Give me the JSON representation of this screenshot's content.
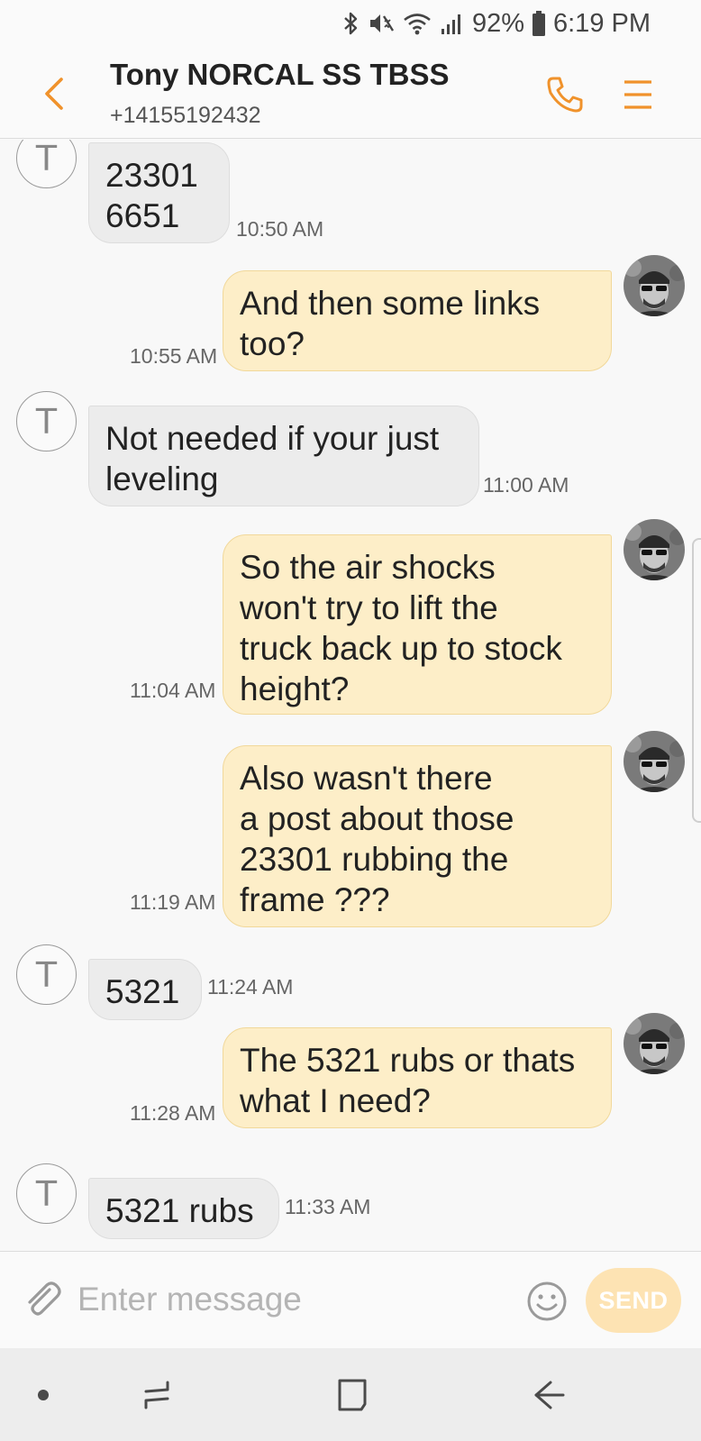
{
  "status_bar": {
    "battery": "92%",
    "time": "6:19 PM"
  },
  "header": {
    "contact_name": "Tony NORCAL SS TBSS",
    "contact_number": "+14155192432",
    "back_icon": "back-chevron-icon",
    "call_icon": "phone-icon",
    "menu_icon": "menu-icon"
  },
  "messages": [
    {
      "direction": "in",
      "lines": [
        "23301",
        "6651"
      ],
      "time": "10:50 AM"
    },
    {
      "direction": "out",
      "lines": [
        "And then some links",
        "too?"
      ],
      "time": "10:55 AM"
    },
    {
      "direction": "in",
      "lines": [
        "Not needed if your just",
        "leveling"
      ],
      "time": "11:00 AM"
    },
    {
      "direction": "out",
      "lines": [
        "So the air shocks",
        "won't try to lift the",
        "truck back up to stock",
        "height?"
      ],
      "time": "11:04 AM"
    },
    {
      "direction": "out",
      "lines": [
        "Also wasn't there",
        "a post about those",
        "23301 rubbing the",
        "frame ???"
      ],
      "time": "11:19 AM"
    },
    {
      "direction": "in",
      "lines": [
        "5321"
      ],
      "time": "11:24 AM"
    },
    {
      "direction": "out",
      "lines": [
        "The 5321 rubs or thats",
        "what I need?"
      ],
      "time": "11:28 AM"
    },
    {
      "direction": "in",
      "lines": [
        "5321 rubs"
      ],
      "time": "11:33 AM"
    }
  ],
  "contact_avatar_letter": "T",
  "composer": {
    "placeholder": "Enter message",
    "value": "",
    "send_label": "SEND"
  },
  "colors": {
    "accent": "#f0922b",
    "incoming_bubble": "#ececec",
    "outgoing_bubble": "#fdeec8",
    "send_button": "#fde3b3"
  }
}
